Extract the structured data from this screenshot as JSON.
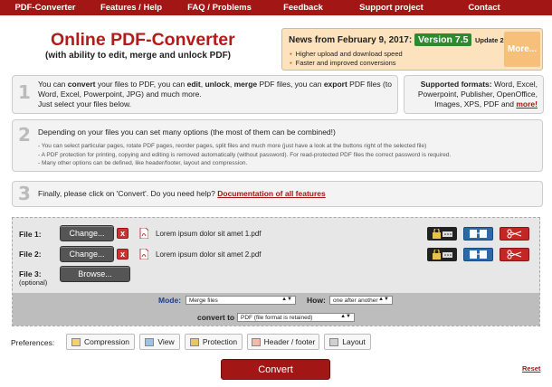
{
  "nav": {
    "items": [
      "PDF-Converter",
      "Features / Help",
      "FAQ / Problems",
      "Feedback",
      "Support project",
      "Contact"
    ]
  },
  "header": {
    "title": "Online PDF-Converter",
    "subtitle": "(with ability to edit, merge and unlock PDF)"
  },
  "news": {
    "title": "News from February 9, 2017:",
    "version": "Version 7.5",
    "update": "Update 2",
    "items": [
      "Higher upload and download speed",
      "Faster and improved conversions"
    ],
    "more_label": "More..."
  },
  "steps": {
    "step1": {
      "number": "1",
      "t1": "You can ",
      "b1": "convert",
      "t2": " your files to PDF, you can ",
      "b2": "edit",
      "t3": ", ",
      "b3": "unlock",
      "t4": ", ",
      "b4": "merge",
      "t5": " PDF files, you can ",
      "b5": "export",
      "t6": " PDF files (to Word, Excel, Powerpoint, JPG) and much more.",
      "line2": "Just select your files below."
    },
    "formats": {
      "label": "Supported formats:",
      "list": "Word, Excel, Powerpoint, Publisher, OpenOffice, Images, XPS, PDF and",
      "more": "more!"
    },
    "step2": {
      "number": "2",
      "text": "Depending on your files you can set many options (the most of them can be combined!)",
      "bullets": [
        "- You can select particular pages, rotate PDF pages, reorder pages, split files and much more (just have a look at the buttons right of the selected file)",
        "- A PDF protection for printing, copying and editing is removed automatically (without password). For read-protected PDF files the correct password is required.",
        "- Many other options can be defined, like header/footer, layout and compression."
      ]
    },
    "step3": {
      "number": "3",
      "text": "Finally, please click on 'Convert'. Do you need help?",
      "link": "Documentation of all features"
    }
  },
  "files": {
    "file1": {
      "label": "File 1:",
      "button": "Change...",
      "name": "Lorem ipsum dolor sit amet 1.pdf"
    },
    "file2": {
      "label": "File 2:",
      "button": "Change...",
      "name": "Lorem ipsum dolor sit amet 2.pdf"
    },
    "file3": {
      "label": "File 3:",
      "optional": "(optional)",
      "button": "Browse..."
    },
    "remove_icon": "x"
  },
  "mode": {
    "label": "Mode:",
    "value": "Merge files",
    "how_label": "How:",
    "how_value": "one after another",
    "convert_label": "convert to",
    "convert_value": "PDF (file format is retained)"
  },
  "preferences": {
    "label": "Preferences:",
    "buttons": [
      "Compression",
      "View",
      "Protection",
      "Header / footer",
      "Layout"
    ]
  },
  "actions": {
    "convert": "Convert",
    "reset": "Reset"
  },
  "colors": {
    "brand_red": "#a31616",
    "news_bg": "#fce3bd",
    "version_green": "#2e8a2e"
  }
}
